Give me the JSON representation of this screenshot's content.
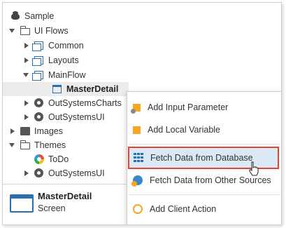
{
  "tree": {
    "items": [
      {
        "label": "Sample"
      },
      {
        "label": "UI Flows"
      },
      {
        "label": "Common"
      },
      {
        "label": "Layouts"
      },
      {
        "label": "MainFlow"
      },
      {
        "label": "MasterDetail"
      },
      {
        "label": "OutSystemsCharts"
      },
      {
        "label": "OutSystemsUI"
      },
      {
        "label": "Images"
      },
      {
        "label": "Themes"
      },
      {
        "label": "ToDo"
      },
      {
        "label": "OutSystemsUI"
      }
    ]
  },
  "selection_panel": {
    "name": "MasterDetail",
    "type": "Screen"
  },
  "context_menu": {
    "items": [
      {
        "label": "Add Input Parameter",
        "icon": "input-parameter-icon"
      },
      {
        "label": "Add Local Variable",
        "icon": "local-variable-icon"
      },
      {
        "label": "Fetch Data from Database",
        "icon": "aggregate-icon"
      },
      {
        "label": "Fetch Data from Other Sources",
        "icon": "data-action-icon"
      },
      {
        "label": "Add Client Action",
        "icon": "client-action-icon"
      }
    ],
    "highlight_color": "#e0452f",
    "hover_color": "#dbe9f7"
  }
}
